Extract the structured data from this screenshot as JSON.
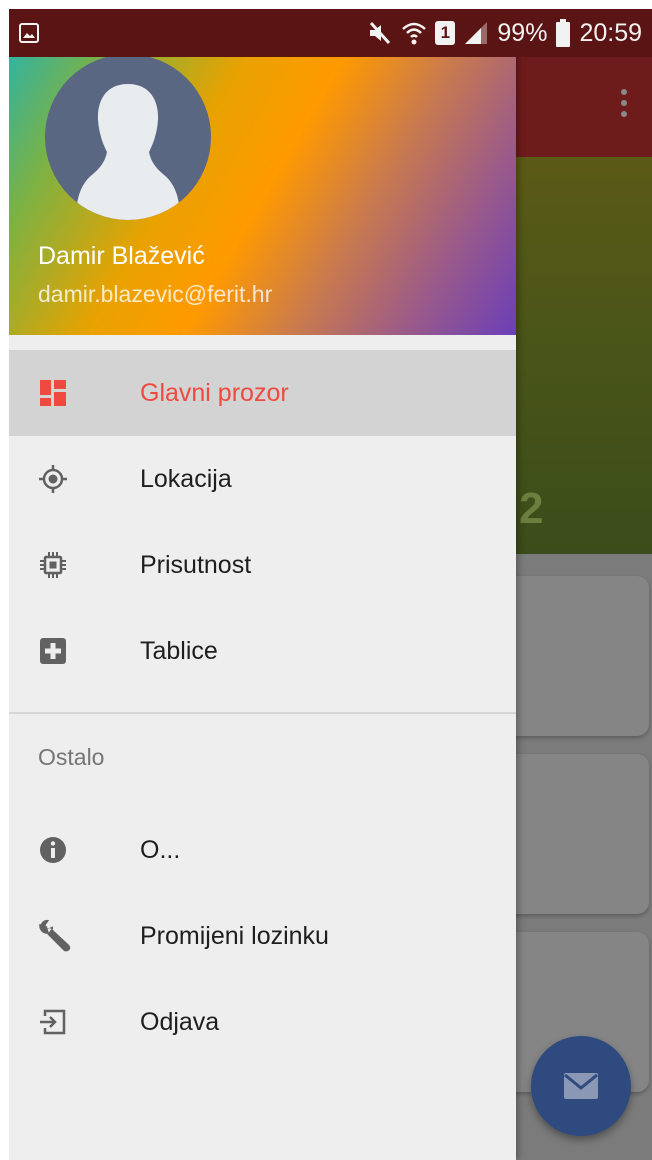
{
  "status_bar": {
    "battery_percent": "99%",
    "time": "20:59",
    "sim_label": "1",
    "icons": [
      "image-notification-icon",
      "mute-icon",
      "wifi-icon",
      "sim-icon",
      "signal-icon",
      "battery-icon"
    ]
  },
  "drawer": {
    "header": {
      "name": "Damir Blažević",
      "email": "damir.blazevic@ferit.hr"
    },
    "items": [
      {
        "label": "Glavni prozor",
        "icon": "dashboard-icon",
        "selected": true
      },
      {
        "label": "Lokacija",
        "icon": "gps-location-icon",
        "selected": false
      },
      {
        "label": "Prisutnost",
        "icon": "chip-icon",
        "selected": false
      },
      {
        "label": "Tablice",
        "icon": "plus-box-icon",
        "selected": false
      }
    ],
    "section_title": "Ostalo",
    "section_items": [
      {
        "label": "O...",
        "icon": "info-icon"
      },
      {
        "label": "Promijeni lozinku",
        "icon": "wrench-icon"
      },
      {
        "label": "Odjava",
        "icon": "logout-icon"
      }
    ]
  },
  "background_app": {
    "hero_digit": "2",
    "fab_icon": "mail-icon",
    "menu_icon": "overflow-menu-icon"
  },
  "colors": {
    "accent": "#f04a40",
    "selected_row": "#d3d3d3",
    "drawer_bg": "#eeeeee",
    "avatar_bg": "#5a6782",
    "fab": "#2e4a7e"
  }
}
